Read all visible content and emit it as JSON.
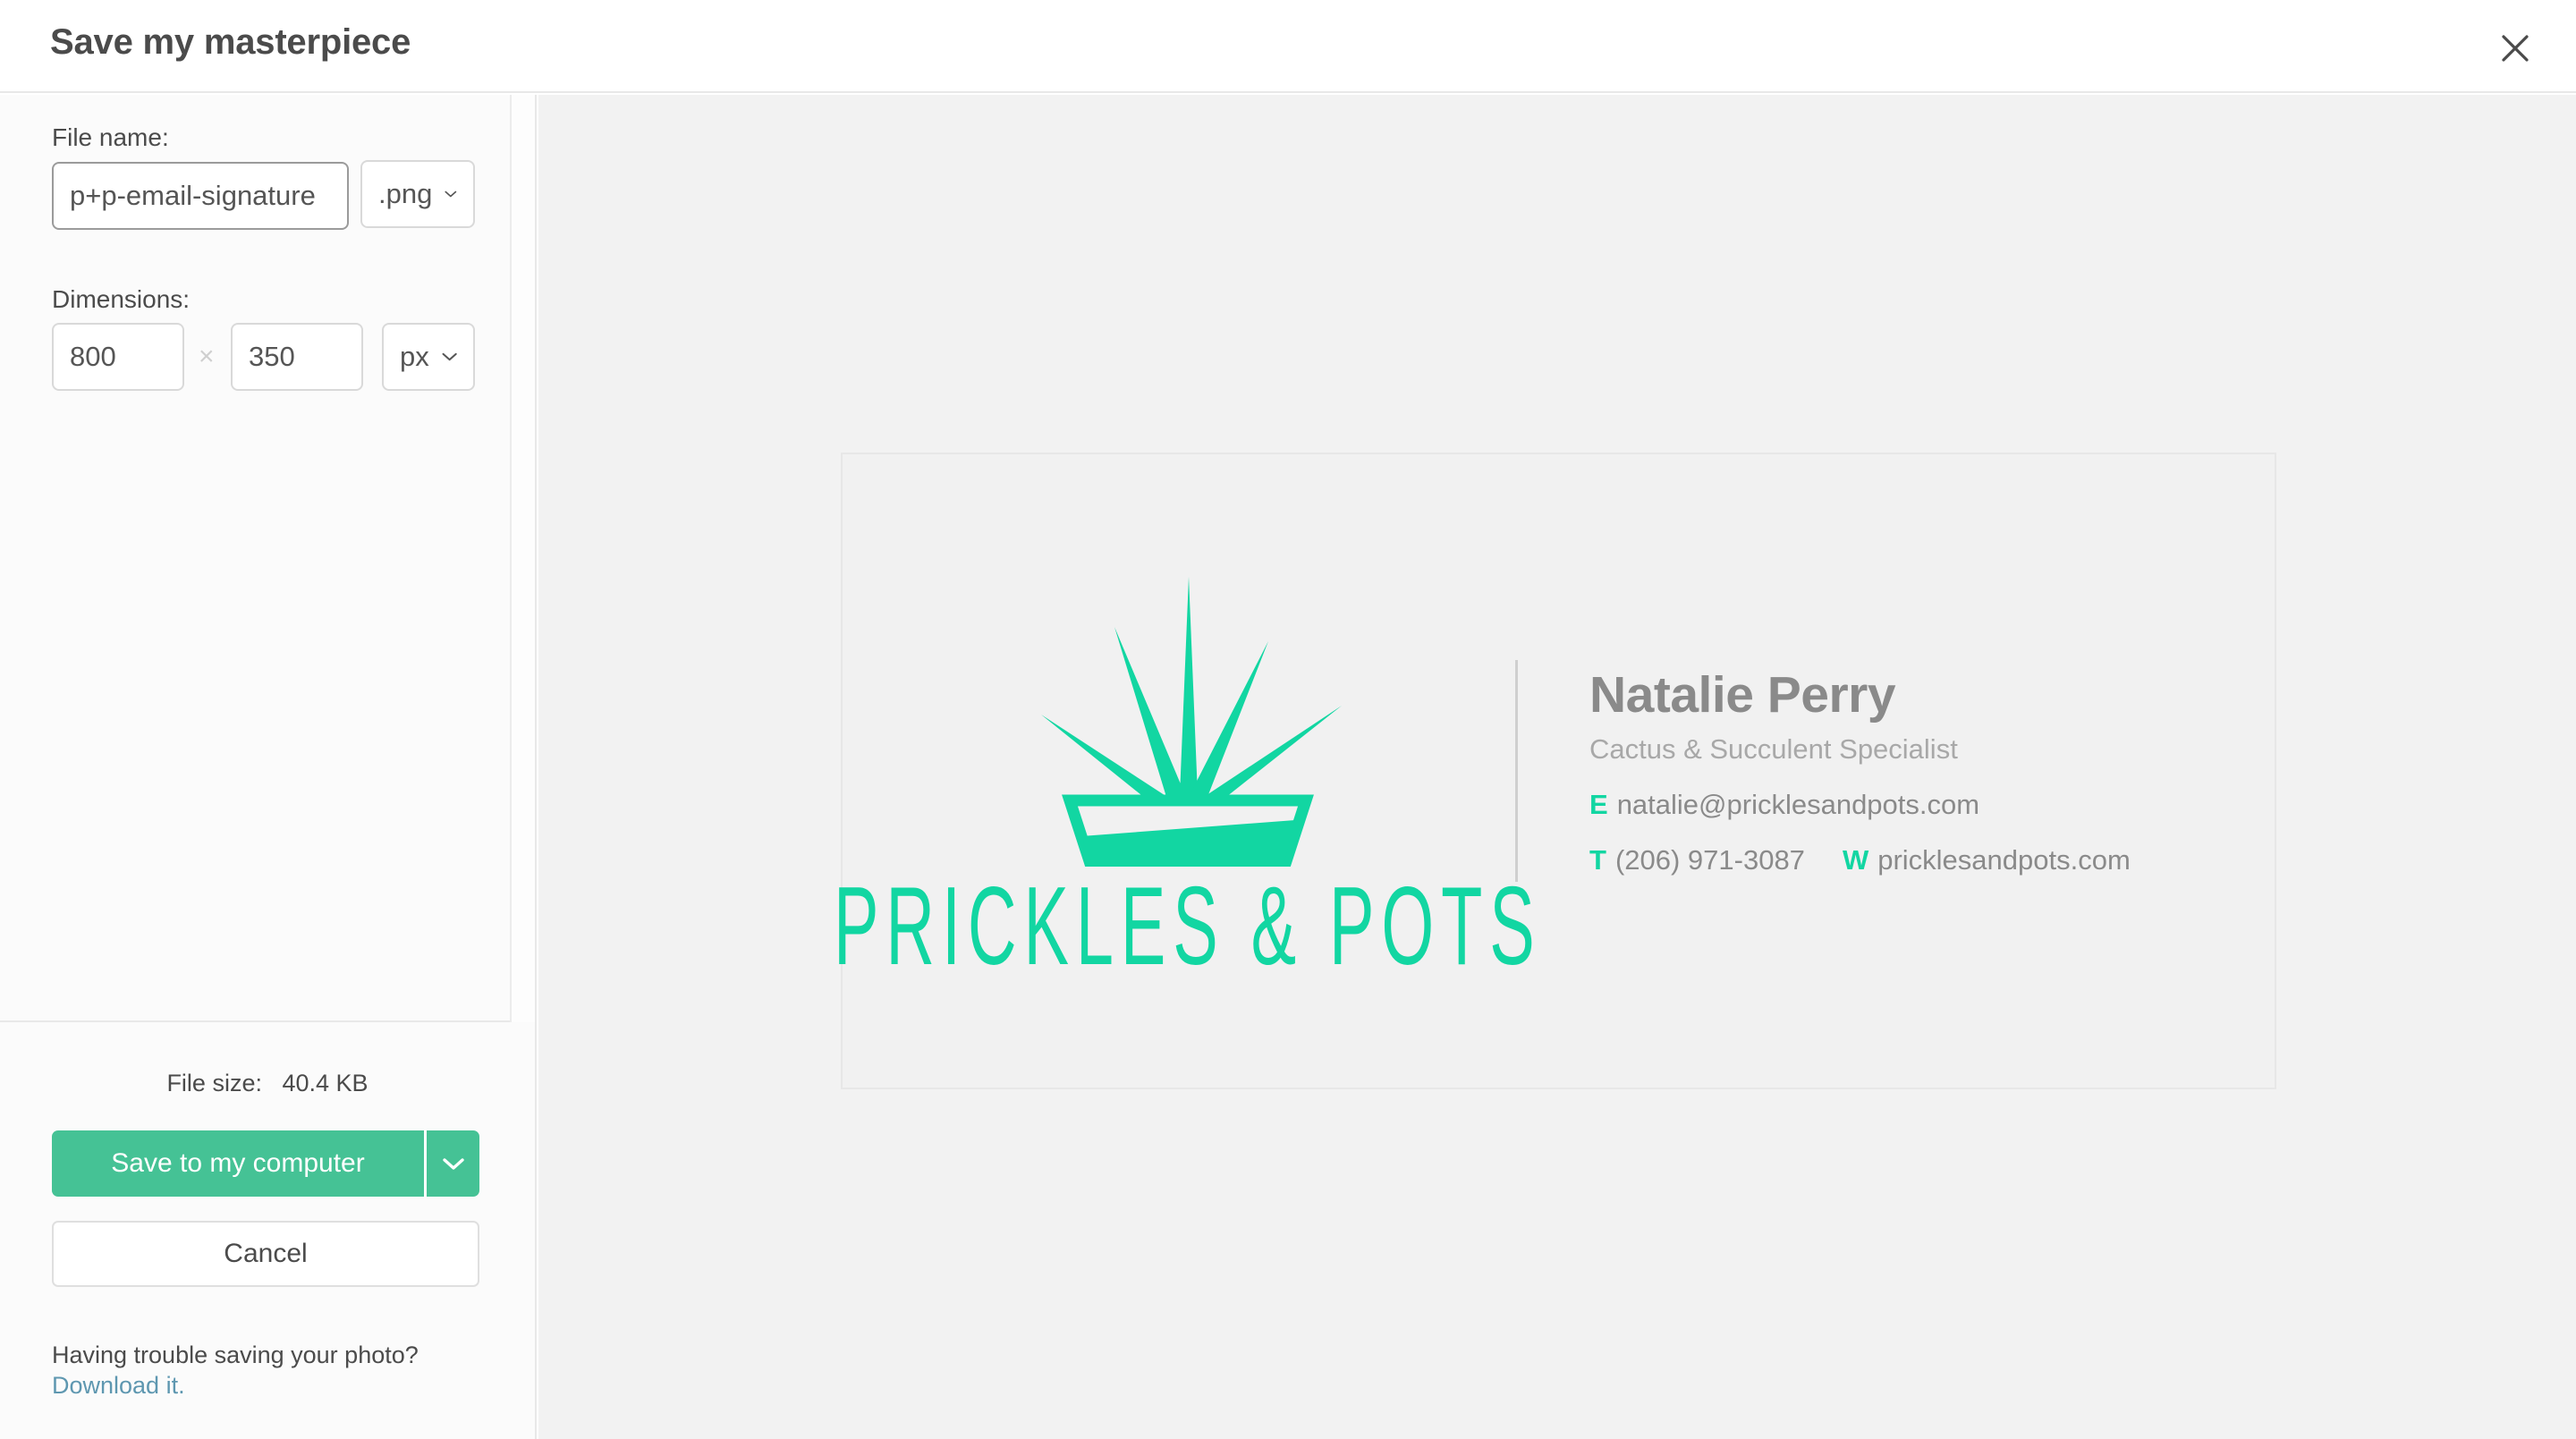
{
  "titlebar": {
    "title": "Save my masterpiece",
    "close_icon": "close-icon"
  },
  "form": {
    "filename_label": "File name:",
    "filename_value": "p+p-email-signature",
    "filename_placeholder": "File name",
    "format_value": ".png",
    "format_caret_icon": "chevron-down-icon",
    "dimensions_label": "Dimensions:",
    "width_value": "800",
    "height_value": "350",
    "times_symbol": "×",
    "unit_value": "px",
    "unit_caret_icon": "chevron-down-icon"
  },
  "footer": {
    "filesize_label": "File size:",
    "filesize_value": "40.4 KB",
    "save_label": "Save to my computer",
    "save_caret_icon": "chevron-down-icon",
    "cancel_label": "Cancel",
    "trouble_text": "Having trouble saving your photo?",
    "download_link": "Download it."
  },
  "preview": {
    "logo": {
      "wordmark": "PRICKLES & POTS",
      "icon": "cactus-in-pot-icon",
      "color": "#12d6a2"
    },
    "contact": {
      "name": "Natalie Perry",
      "role": "Cactus & Succulent Specialist",
      "email_key": "E",
      "email_value": "natalie@pricklesandpots.com",
      "phone_key": "T",
      "phone_value": "(206) 971-3087",
      "web_key": "W",
      "web_value": "pricklesandpots.com"
    }
  },
  "colors": {
    "brand_green": "#12d6a2",
    "button_green": "#45c295",
    "link_blue": "#5e97b0",
    "stage_bg": "#f2f2f2"
  }
}
